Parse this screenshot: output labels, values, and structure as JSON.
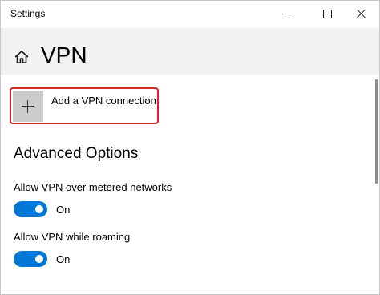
{
  "window": {
    "title": "Settings"
  },
  "header": {
    "home_icon": "home-icon",
    "title": "VPN"
  },
  "add_vpn": {
    "icon": "plus-icon",
    "label": "Add a VPN connection",
    "highlight_color": "#d9232d"
  },
  "advanced": {
    "title": "Advanced Options",
    "settings": [
      {
        "label": "Allow VPN over metered networks",
        "state": "On",
        "enabled": true
      },
      {
        "label": "Allow VPN while roaming",
        "state": "On",
        "enabled": true
      }
    ]
  },
  "colors": {
    "accent": "#0078d7",
    "header_bg": "#f2f2f2"
  }
}
